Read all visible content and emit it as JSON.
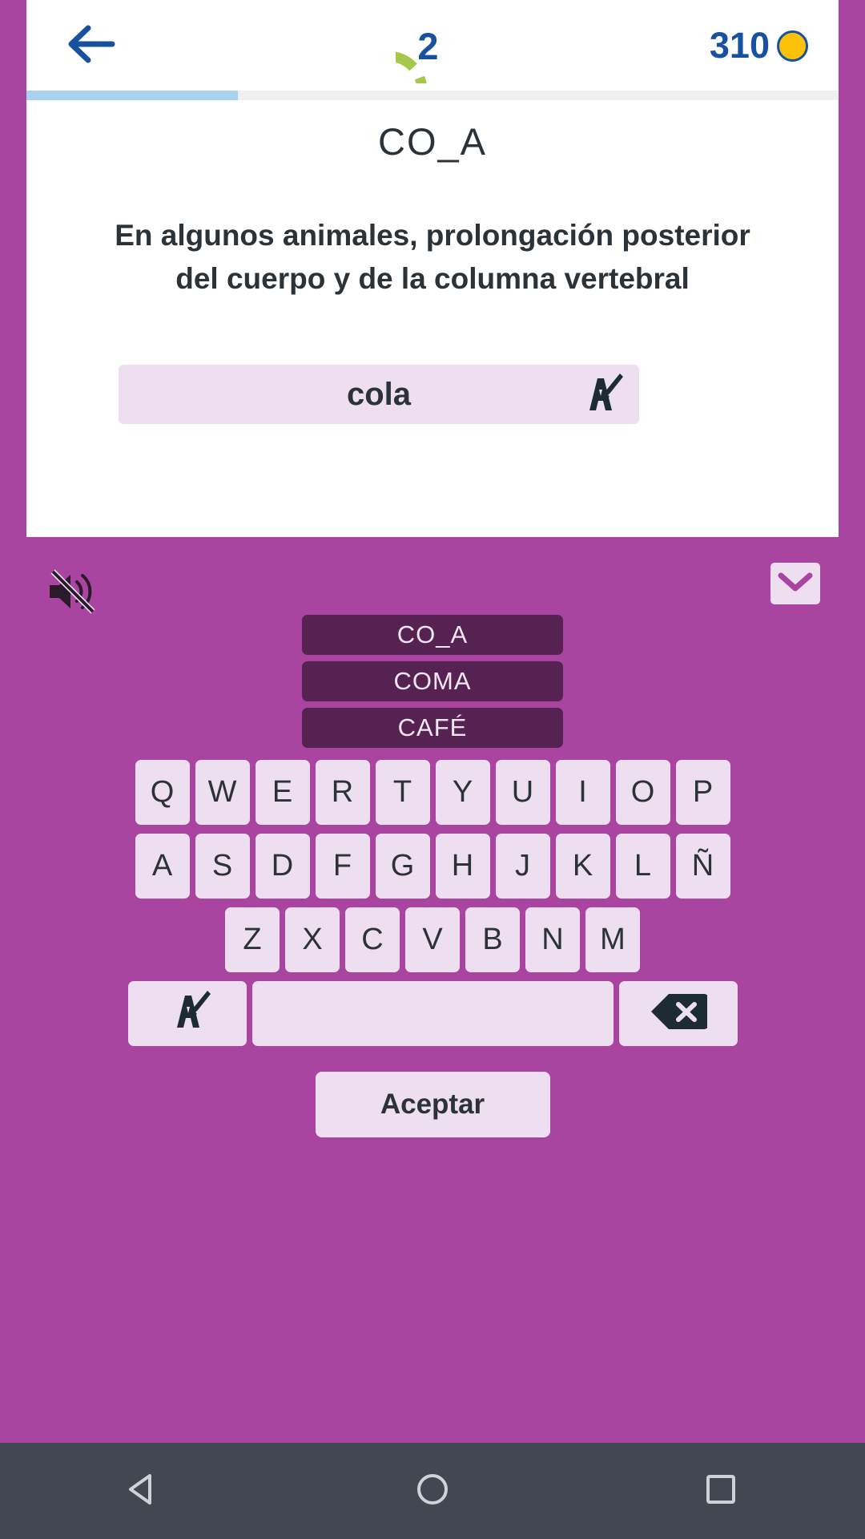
{
  "app": {
    "accent_purple": "#a944a0",
    "dark_purple": "#552252",
    "key_pink": "#eedff0",
    "blue": "#18519e",
    "coin_yellow": "#fcc20a",
    "green": "#a5c84a",
    "progress_blue": "#a8d2f0",
    "navbar_gray": "#424852"
  },
  "header": {
    "back_icon": "arrow-left-icon",
    "timer_value": "2",
    "timer_ring_color": "#a5c84a",
    "coins_value": "310",
    "coin_icon": "coin-icon"
  },
  "progress": {
    "percent": 26
  },
  "card": {
    "puzzle_word": "CO_A",
    "clue": "En algunos animales, prolongación posterior del cuerpo y de la columna vertebral",
    "answer_value": "cola",
    "answer_placeholder": "",
    "handwriting_icon": "handwriting-icon"
  },
  "play": {
    "mute_icon": "speaker-muted-icon",
    "mail_icon": "envelope-icon",
    "options": [
      {
        "label": "CO_A"
      },
      {
        "label": "COMA"
      },
      {
        "label": "CAFÉ"
      }
    ]
  },
  "keyboard": {
    "row1": [
      "Q",
      "W",
      "E",
      "R",
      "T",
      "Y",
      "U",
      "I",
      "O",
      "P"
    ],
    "row2": [
      "A",
      "S",
      "D",
      "F",
      "G",
      "H",
      "J",
      "K",
      "L",
      "Ñ"
    ],
    "row3": [
      "Z",
      "X",
      "C",
      "V",
      "B",
      "N",
      "M"
    ],
    "fn_handwriting_icon": "handwriting-icon",
    "space_label": "",
    "backspace_icon": "backspace-icon",
    "accept_label": "Aceptar"
  },
  "navbar": {
    "back_icon": "triangle-back-icon",
    "home_icon": "circle-home-icon",
    "recents_icon": "square-recents-icon"
  }
}
